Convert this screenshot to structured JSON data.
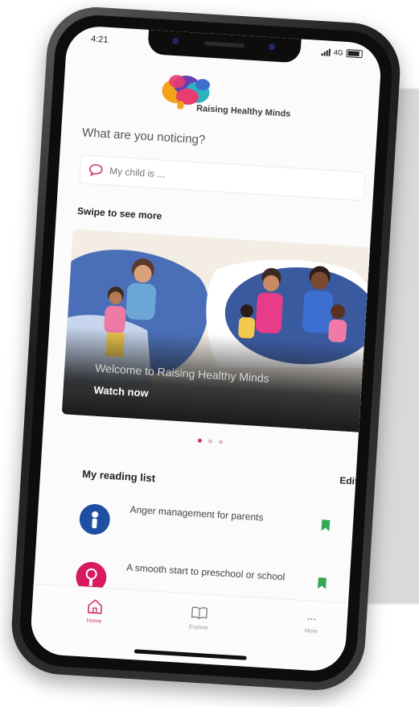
{
  "status_bar": {
    "time": "4:21",
    "network": "4G"
  },
  "header": {
    "app_name": "Raising Healthy Minds"
  },
  "prompt": {
    "question": "What are you noticing?"
  },
  "search": {
    "placeholder": "My child is ..."
  },
  "carousel": {
    "heading": "Swipe to see more",
    "slide": {
      "title": "Welcome to Raising Healthy Minds",
      "cta": "Watch now"
    },
    "page_count": 3,
    "active_index": 0
  },
  "reading_list": {
    "title": "My reading list",
    "edit_label": "Edit",
    "items": [
      {
        "title": "Anger management for parents",
        "thumb_color": "#1e4fa3",
        "bookmark_color": "#34a853"
      },
      {
        "title": "A smooth start to preschool or school",
        "thumb_color": "#d81b60",
        "bookmark_color": "#34a853"
      }
    ]
  },
  "tabbar": {
    "tabs": [
      {
        "label": "Home",
        "icon": "home-icon",
        "active": true
      },
      {
        "label": "Explore",
        "icon": "book-icon",
        "active": false
      },
      {
        "label": "More",
        "icon": "more-icon",
        "active": false
      }
    ]
  },
  "colors": {
    "accent": "#d1336e",
    "bookmark": "#34a853"
  }
}
